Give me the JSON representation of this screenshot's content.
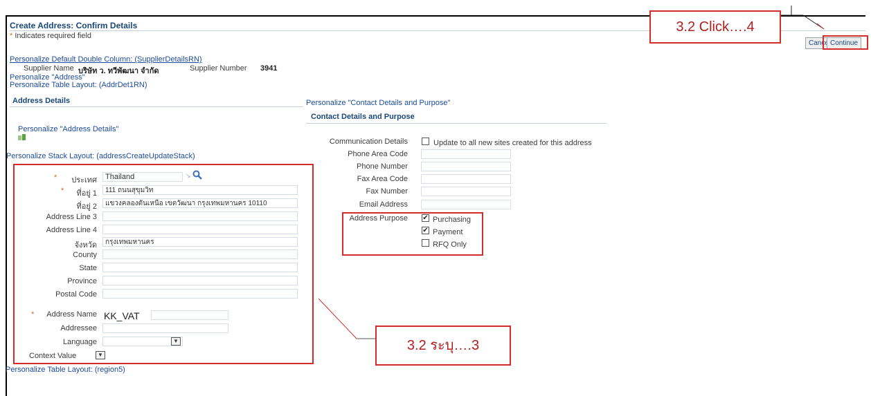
{
  "page": {
    "title": "Create Address: Confirm Details",
    "required_star": "*",
    "required_note": "Indicates required field"
  },
  "buttons": {
    "cancel": "Cancel",
    "continue": "Continue"
  },
  "supplier": {
    "personalize_link": "Personalize Default Double Column: (SupplierDetailsRN)",
    "name_label": "Supplier Name",
    "name_value": "บริษัท ว. ทวีพัฒนา จำกัด",
    "number_label": "Supplier Number",
    "number_value": "3941"
  },
  "links": {
    "personalize_address": "Personalize \"Address\"",
    "personalize_table_addr": "Personalize Table Layout: (AddrDet1RN)",
    "personalize_address_details": "Personalize \"Address Details\"",
    "personalize_stack": "Personalize Stack Layout: (addressCreateUpdateStack)",
    "personalize_contact": "Personalize \"Contact Details and Purpose\"",
    "personalize_region5": "Personalize Table Layout: (region5)"
  },
  "address_details": {
    "heading": "Address Details",
    "fields": [
      {
        "label": "ประเทศ",
        "value": "Thailand",
        "required": true
      },
      {
        "label": "ที่อยู่ 1",
        "value": "111 ถนนสุขุมวิท",
        "required": true
      },
      {
        "label": "ที่อยู่ 2",
        "value": "แขวงคลองตันเหนือ เขตวัฒนา กรุงเทพมหานคร 10110",
        "required": false
      },
      {
        "label": "Address Line 3",
        "value": "",
        "required": false
      },
      {
        "label": "Address Line 4",
        "value": "",
        "required": false
      },
      {
        "label": "จังหวัด",
        "value": "กรุงเทพมหานคร",
        "required": false
      },
      {
        "label": "County",
        "value": "",
        "required": false
      },
      {
        "label": "State",
        "value": "",
        "required": false
      },
      {
        "label": "Province",
        "value": "",
        "required": false
      },
      {
        "label": "Postal Code",
        "value": "",
        "required": false
      }
    ],
    "address_name_label": "Address Name",
    "address_name_value": "KK_VAT",
    "addressee_label": "Addressee",
    "addressee_value": "",
    "language_label": "Language",
    "language_value": "",
    "context_label": "Context Value",
    "context_value": ""
  },
  "contact": {
    "heading": "Contact Details and Purpose",
    "comm_label": "Communication Details",
    "comm_checkbox_label": "Update to all new sites created for this address",
    "comm_checked": false,
    "fields": [
      {
        "label": "Phone Area Code",
        "value": ""
      },
      {
        "label": "Phone Number",
        "value": ""
      },
      {
        "label": "Fax Area Code",
        "value": ""
      },
      {
        "label": "Fax Number",
        "value": ""
      },
      {
        "label": "Email Address",
        "value": ""
      }
    ],
    "purpose_label": "Address Purpose",
    "purposes": [
      {
        "label": "Purchasing",
        "checked": true
      },
      {
        "label": "Payment",
        "checked": true
      },
      {
        "label": "RFQ Only",
        "checked": false
      }
    ]
  },
  "annotations": {
    "callout_click": "3.2 Click….4",
    "callout_specify": "3.2 ระบุ….3",
    "accent_color": "#d42b2b"
  }
}
